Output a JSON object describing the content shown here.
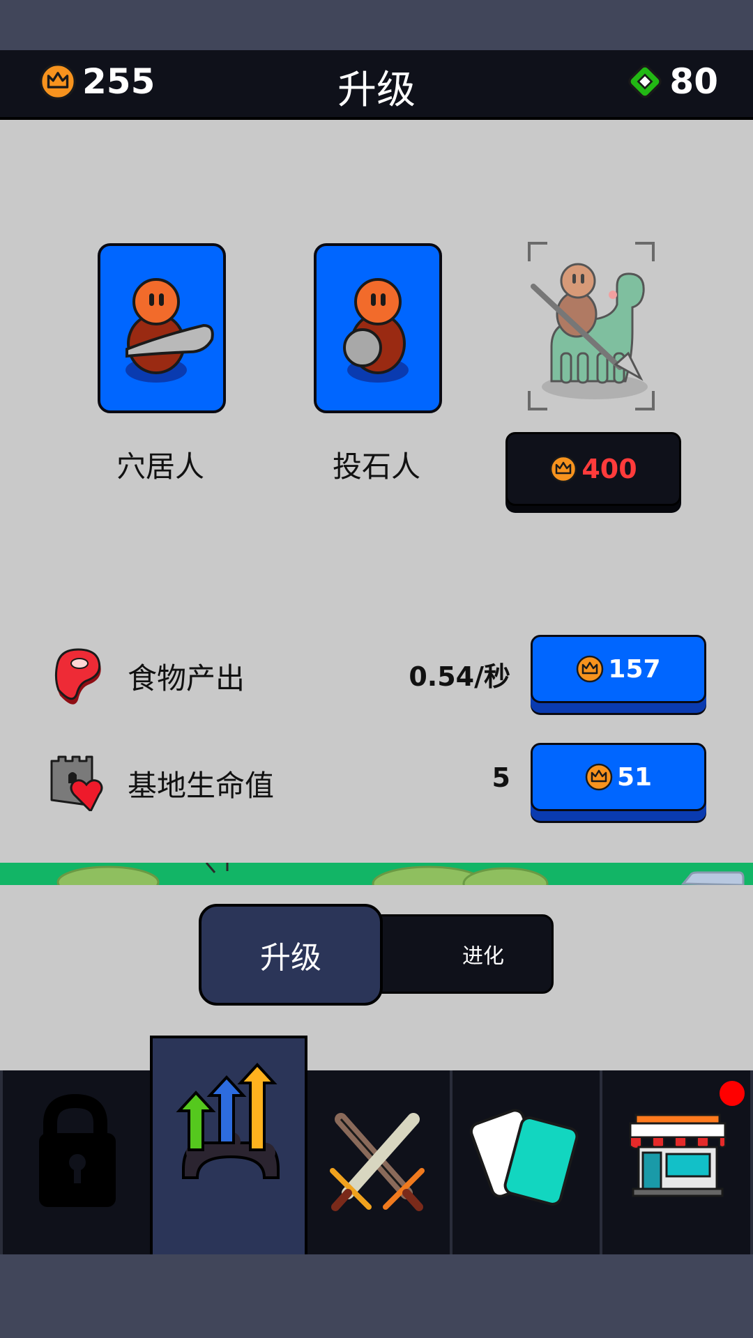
{
  "header": {
    "crowns": "255",
    "title": "升级",
    "gems": "80"
  },
  "units": [
    {
      "name": "穴居人"
    },
    {
      "name": "投石人"
    },
    {
      "price": "400"
    }
  ],
  "stats": [
    {
      "label": "食物产出",
      "value": "0.54/秒",
      "cost": "157"
    },
    {
      "label": "基地生命值",
      "value": "5",
      "cost": "51"
    }
  ],
  "tabs": {
    "upgrade": "升级",
    "evolve": "进化"
  },
  "colors": {
    "card_blue": "#0066ff",
    "topbar": "#0f111a",
    "price_text": "#ff3b3b",
    "notification": "#ff0000"
  },
  "nav": {
    "icons": [
      "lock-icon",
      "upgrade-arrows-icon",
      "crossed-swords-icon",
      "cards-icon",
      "shop-icon"
    ],
    "active_index": 1,
    "shop_has_notification": true
  }
}
